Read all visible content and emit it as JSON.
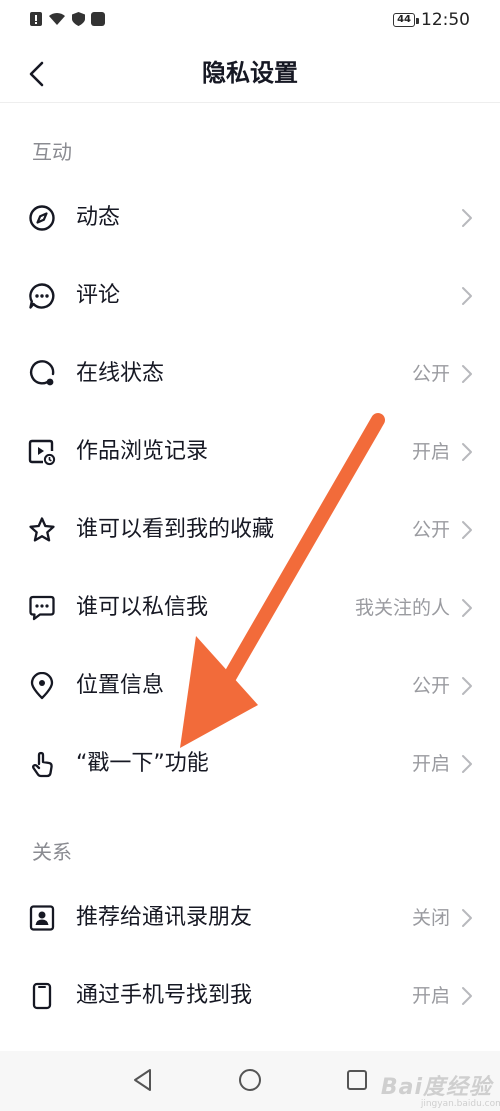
{
  "status_bar": {
    "time": "12:50",
    "battery": "44"
  },
  "header": {
    "title": "隐私设置"
  },
  "sections": [
    {
      "title": "互动"
    },
    {
      "title": "关系"
    }
  ],
  "rows": [
    {
      "label": "动态",
      "value": "",
      "icon": "compass-icon"
    },
    {
      "label": "评论",
      "value": "",
      "icon": "comment-icon"
    },
    {
      "label": "在线状态",
      "value": "公开",
      "icon": "online-status-icon"
    },
    {
      "label": "作品浏览记录",
      "value": "开启",
      "icon": "video-history-icon"
    },
    {
      "label": "谁可以看到我的收藏",
      "value": "公开",
      "icon": "star-icon"
    },
    {
      "label": "谁可以私信我",
      "value": "我关注的人",
      "icon": "message-icon"
    },
    {
      "label": "位置信息",
      "value": "公开",
      "icon": "location-icon"
    },
    {
      "label": "“戳一下”功能",
      "value": "开启",
      "icon": "poke-hand-icon"
    },
    {
      "label": "推荐给通讯录朋友",
      "value": "关闭",
      "icon": "contact-card-icon"
    },
    {
      "label": "通过手机号找到我",
      "value": "开启",
      "icon": "phone-icon"
    }
  ],
  "watermark": {
    "text": "Bai度经验",
    "sub": "jingyan.baidu.com"
  },
  "colors": {
    "annotation_arrow": "#f26b3a",
    "text_primary": "#161823",
    "text_secondary": "#9a9ba0"
  }
}
